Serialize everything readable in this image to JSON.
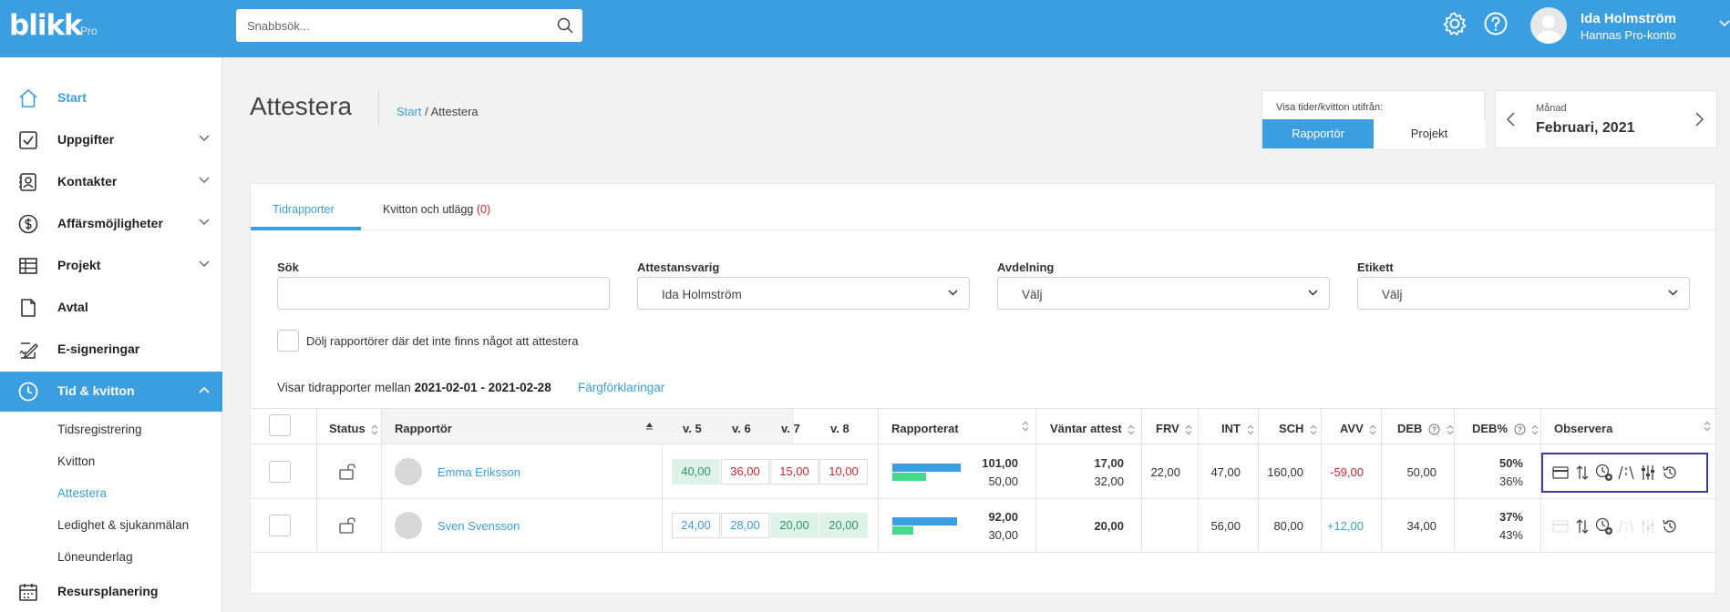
{
  "header": {
    "logo": "blikk",
    "logo_suffix": "Pro",
    "search_placeholder": "Snabbsök...",
    "user_name": "Ida Holmström",
    "user_account": "Hannas Pro-konto"
  },
  "sidebar": {
    "items": [
      {
        "label": "Start",
        "icon": "home-icon"
      },
      {
        "label": "Uppgifter",
        "icon": "checkbox-icon"
      },
      {
        "label": "Kontakter",
        "icon": "contacts-icon"
      },
      {
        "label": "Affärsmöjligheter",
        "icon": "dollar-icon"
      },
      {
        "label": "Projekt",
        "icon": "table-icon"
      },
      {
        "label": "Avtal",
        "icon": "document-icon"
      },
      {
        "label": "E-signeringar",
        "icon": "signature-icon"
      },
      {
        "label": "Tid & kvitton",
        "icon": "clock-icon"
      },
      {
        "label": "Resursplanering",
        "icon": "calendar-icon"
      }
    ],
    "sub_items": [
      "Tidsregistrering",
      "Kvitton",
      "Attestera",
      "Ledighet & sjukanmälan",
      "Löneunderlag"
    ]
  },
  "page": {
    "title": "Attestera",
    "breadcrumb_home": "Start",
    "breadcrumb_sep": "/",
    "breadcrumb_current": "Attestera"
  },
  "view_toggle": {
    "label": "Visa tider/kvitton utifrån:",
    "option_a": "Rapportör",
    "option_b": "Projekt"
  },
  "month_picker": {
    "label": "Månad",
    "value": "Februari, 2021"
  },
  "tabs": {
    "time_reports": "Tidrapporter",
    "receipts": "Kvitton och utlägg",
    "receipts_count": "(0)"
  },
  "filters": {
    "search_label": "Sök",
    "approver_label": "Attestansvarig",
    "approver_value": "Ida Holmström",
    "department_label": "Avdelning",
    "department_value": "Välj",
    "tag_label": "Etikett",
    "tag_value": "Välj",
    "hide_label": "Dölj rapportörer där det inte finns något att attestera"
  },
  "period": {
    "prefix": "Visar tidrapporter mellan",
    "range": "2021-02-01 - 2021-02-28",
    "legend_link": "Färgförklaringar"
  },
  "table": {
    "columns": {
      "status": "Status",
      "reporter": "Rapportör",
      "w5": "v. 5",
      "w6": "v. 6",
      "w7": "v. 7",
      "w8": "v. 8",
      "reported": "Rapporterat",
      "awaiting": "Väntar attest",
      "frv": "FRV",
      "int": "INT",
      "sch": "SCH",
      "avv": "AVV",
      "deb": "DEB",
      "deb_pct": "DEB%",
      "observe": "Observera"
    },
    "rows": [
      {
        "name": "Emma Eriksson",
        "weeks": [
          "40,00",
          "36,00",
          "15,00",
          "10,00"
        ],
        "reported_top": "101,00",
        "reported_bottom": "50,00",
        "reported_blue_fraction": 0.9,
        "reported_green_fraction": 0.45,
        "awaiting_top": "17,00",
        "awaiting_bottom": "32,00",
        "frv": "22,00",
        "int": "47,00",
        "sch": "160,00",
        "avv": "-59,00",
        "deb": "50,00",
        "deb_pct_top": "50%",
        "deb_pct_bottom": "36%"
      },
      {
        "name": "Sven Svensson",
        "weeks": [
          "24,00",
          "28,00",
          "20,00",
          "20,00"
        ],
        "reported_top": "92,00",
        "reported_bottom": "30,00",
        "reported_blue_fraction": 0.85,
        "reported_green_fraction": 0.28,
        "awaiting_top": "20,00",
        "frv": "",
        "int": "56,00",
        "sch": "80,00",
        "avv": "+12,00",
        "deb": "34,00",
        "deb_pct_top": "37%",
        "deb_pct_bottom": "43%"
      }
    ]
  },
  "colors": {
    "brand": "#3a9ee0",
    "negative": "#d0242f",
    "approved_bg": "#dff2e9",
    "approved_text": "#2c9a5c",
    "bar_green": "#47d98a"
  }
}
